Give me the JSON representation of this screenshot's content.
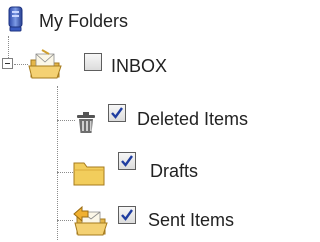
{
  "tree": {
    "root": {
      "label": "My Folders",
      "icon": "server-icon"
    },
    "inbox": {
      "label": "INBOX",
      "icon": "open-envelope-folder-icon",
      "checked": false,
      "expanded": true
    },
    "children": [
      {
        "label": "Deleted Items",
        "icon": "trash-icon",
        "checked": true
      },
      {
        "label": "Drafts",
        "icon": "folder-icon",
        "checked": true
      },
      {
        "label": "Sent Items",
        "icon": "sent-mail-icon",
        "checked": true
      }
    ]
  },
  "colors": {
    "checkmark": "#1f3da0",
    "folder_yellow": "#f2cd5c",
    "connector": "#8c8c8c"
  }
}
